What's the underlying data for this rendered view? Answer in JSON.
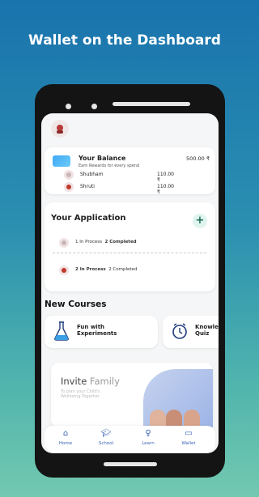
{
  "headline": "Wallet on the Dashboard",
  "balance": {
    "title": "Your Balance",
    "subtitle": "Earn Rewards for every spend",
    "amount": "500.00 ₹",
    "kids": [
      {
        "name": "Shubham",
        "amount": "110.00 ₹"
      },
      {
        "name": "Shruti",
        "amount": "110.00 ₹"
      }
    ]
  },
  "application": {
    "title": "Your Application",
    "add_label": "+",
    "rows": [
      {
        "in_process": "1 In Process",
        "completed": "2 Completed"
      },
      {
        "in_process": "2 In Process",
        "completed": "2 Completed"
      }
    ]
  },
  "courses": {
    "title": "New Courses",
    "items": [
      {
        "label_line1": "Fun with",
        "label_line2": "Experiments",
        "icon": "flask-icon"
      },
      {
        "label_line1": "Knowle",
        "label_line2": "Quiz",
        "icon": "alarm-clock-icon"
      }
    ]
  },
  "invite": {
    "title_main": "Invite",
    "title_accent": "Family",
    "subtitle_line1": "To plan your Child's",
    "subtitle_line2": "Wellbeing Together"
  },
  "nav": [
    {
      "label": "Home",
      "icon": "home-icon"
    },
    {
      "label": "School",
      "icon": "graduation-cap-icon"
    },
    {
      "label": "Learn",
      "icon": "lightbulb-icon"
    },
    {
      "label": "Wallet",
      "icon": "wallet-icon"
    }
  ],
  "colors": {
    "accent": "#3b63b6",
    "plus_bg": "#e0f4ef"
  }
}
